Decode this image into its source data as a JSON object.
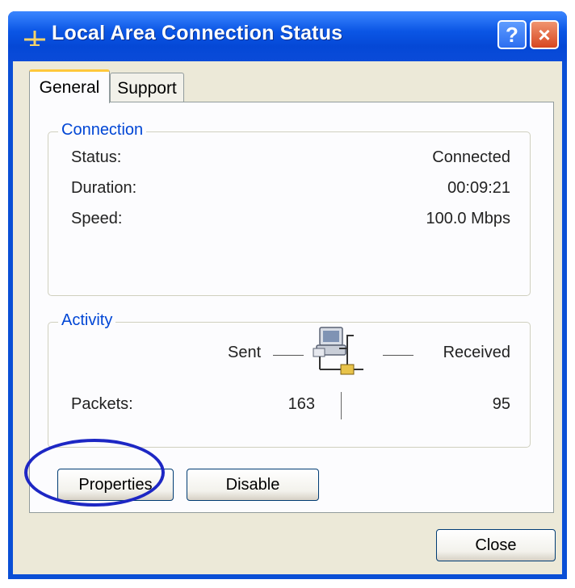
{
  "window": {
    "title": "Local Area Connection Status",
    "help_glyph": "?",
    "close_glyph": "×"
  },
  "tabs": [
    {
      "label": "General",
      "active": true
    },
    {
      "label": "Support",
      "active": false
    }
  ],
  "connection": {
    "group_label": "Connection",
    "rows": [
      {
        "label": "Status:",
        "value": "Connected"
      },
      {
        "label": "Duration:",
        "value": "00:09:21"
      },
      {
        "label": "Speed:",
        "value": "100.0 Mbps"
      }
    ]
  },
  "activity": {
    "group_label": "Activity",
    "sent_label": "Sent",
    "received_label": "Received",
    "packets_label": "Packets:",
    "packets_sent": "163",
    "packets_received": "95",
    "icon": "network-computer-icon"
  },
  "buttons": {
    "properties": "Properties",
    "disable": "Disable",
    "close": "Close"
  },
  "colors": {
    "titlebar": "#0b56e5",
    "group_label": "#0046d5",
    "highlight": "#1d27c4",
    "dialog_bg": "#ece9d8"
  }
}
